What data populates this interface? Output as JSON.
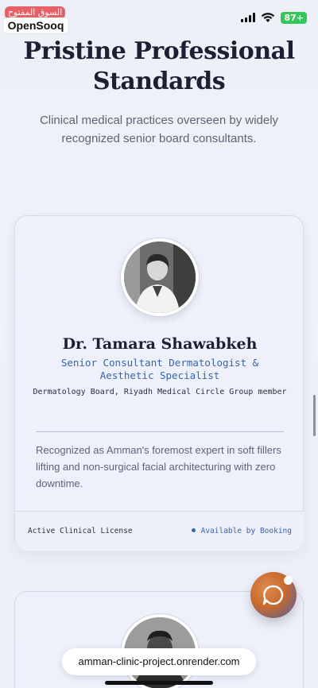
{
  "status_bar": {
    "badge_text": "السوق المفتوح",
    "app_name": "OpenSooq",
    "battery": "87+",
    "colors": {
      "battery": "#34c759",
      "badge": "#e5484d"
    }
  },
  "section": {
    "title": "Pristine Professional Standards",
    "subtitle": "Clinical medical practices overseen by widely recognized senior board consultants."
  },
  "doctor_card": {
    "name": "Dr. Tamara Shawabkeh",
    "title": "Senior Consultant Dermatologist & Aesthetic Specialist",
    "board": "Dermatology Board, Riyadh Medical Circle Group member",
    "description": "Recognized as Amman's foremost expert in soft fillers lifting and non-surgical facial architecturing with zero downtime.",
    "license": "Active Clinical License",
    "availability": "Available by Booking",
    "accent_color": "#3a63a8"
  },
  "browser": {
    "url": "amman-clinic-project.onrender.com"
  },
  "icons": [
    "signal-icon",
    "wifi-icon",
    "battery-icon",
    "chat-icon",
    "avatar-photo"
  ]
}
